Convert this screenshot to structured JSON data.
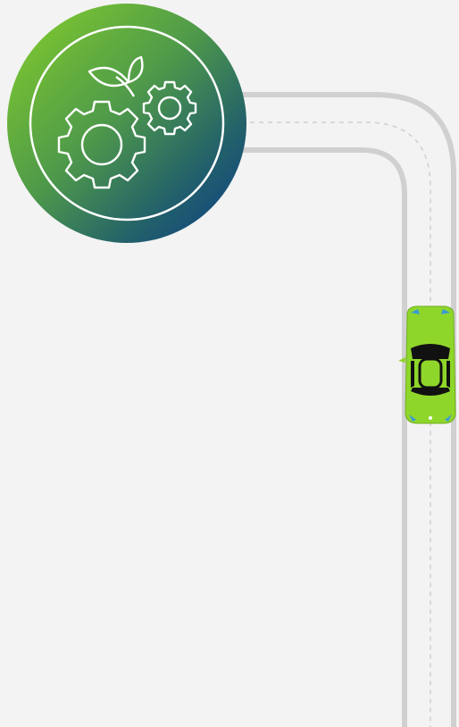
{
  "colors": {
    "background": "#f3f3f3",
    "road_edge": "#d0d0d0",
    "lane_marking": "#cfcfcf",
    "badge_gradient_start": "#86d02a",
    "badge_gradient_mid": "#2f7a5f",
    "badge_gradient_end": "#0b3d8a",
    "icon_stroke": "#ffffff",
    "car_body": "#8fd62a",
    "car_glass": "#111111",
    "car_accent": "#3a9bd6"
  },
  "badge": {
    "icon": "gears-and-leaf-icon"
  },
  "road": {
    "style": "curved-road-with-dashed-center-line"
  },
  "car": {
    "icon": "car-icon",
    "direction": "up"
  }
}
